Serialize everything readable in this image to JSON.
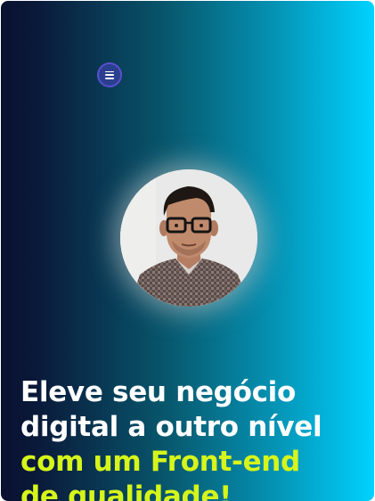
{
  "hero": {
    "menu_icon": "hamburger-menu-icon",
    "avatar_icon": "profile-photo",
    "headline_line1": "Eleve seu negócio",
    "headline_line2": "digital a outro nível",
    "headline_line3": "com um Front-end",
    "headline_line4": "de qualidade!"
  },
  "colors": {
    "gradient_start": "#0a1030",
    "gradient_end": "#00d2ff",
    "headline_white": "#ffffff",
    "headline_highlight": "#d6f51a",
    "menu_button": "#2b3f8f"
  }
}
